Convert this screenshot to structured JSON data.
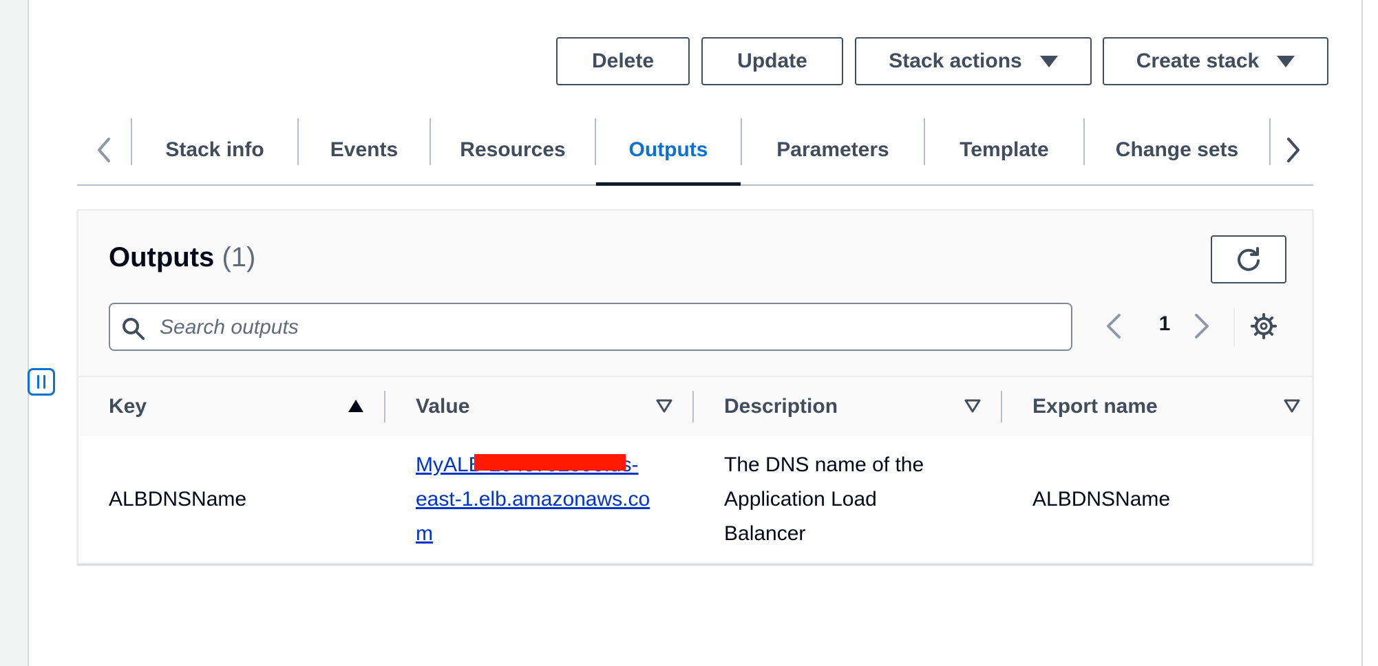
{
  "header_buttons": {
    "delete": "Delete",
    "update": "Update",
    "stack_actions": "Stack actions",
    "create_stack": "Create stack"
  },
  "tabs": [
    {
      "label": "Stack info",
      "active": false
    },
    {
      "label": "Events",
      "active": false
    },
    {
      "label": "Resources",
      "active": false
    },
    {
      "label": "Outputs",
      "active": true
    },
    {
      "label": "Parameters",
      "active": false
    },
    {
      "label": "Template",
      "active": false
    },
    {
      "label": "Change sets",
      "active": false
    }
  ],
  "outputs_panel": {
    "title": "Outputs",
    "count": "(1)",
    "search_placeholder": "Search outputs",
    "page": "1",
    "columns": [
      "Key",
      "Value",
      "Description",
      "Export name"
    ],
    "sorted_column": "Key",
    "rows": [
      {
        "key": "ALBDNSName",
        "value_lines": [
          "MyALB-2045792590.us-",
          "east-1.elb.amazonaws.co",
          "m"
        ],
        "value_redacted": true,
        "description_lines": [
          "The DNS name of the",
          "Application Load",
          "Balancer"
        ],
        "export_name": "ALBDNSName"
      }
    ]
  },
  "colors": {
    "accent_blue": "#0972d3",
    "link_blue": "#0033cc",
    "text_dark": "#16191f",
    "button_border": "#414d5c",
    "redaction": "#ff1a00"
  },
  "icons": [
    "chevron-left-icon",
    "chevron-right-icon",
    "caret-down-icon",
    "refresh-icon",
    "search-icon",
    "settings-gear-icon",
    "sort-ascending-icon",
    "sort-descending-icon",
    "drawer-toggle-icon"
  ]
}
